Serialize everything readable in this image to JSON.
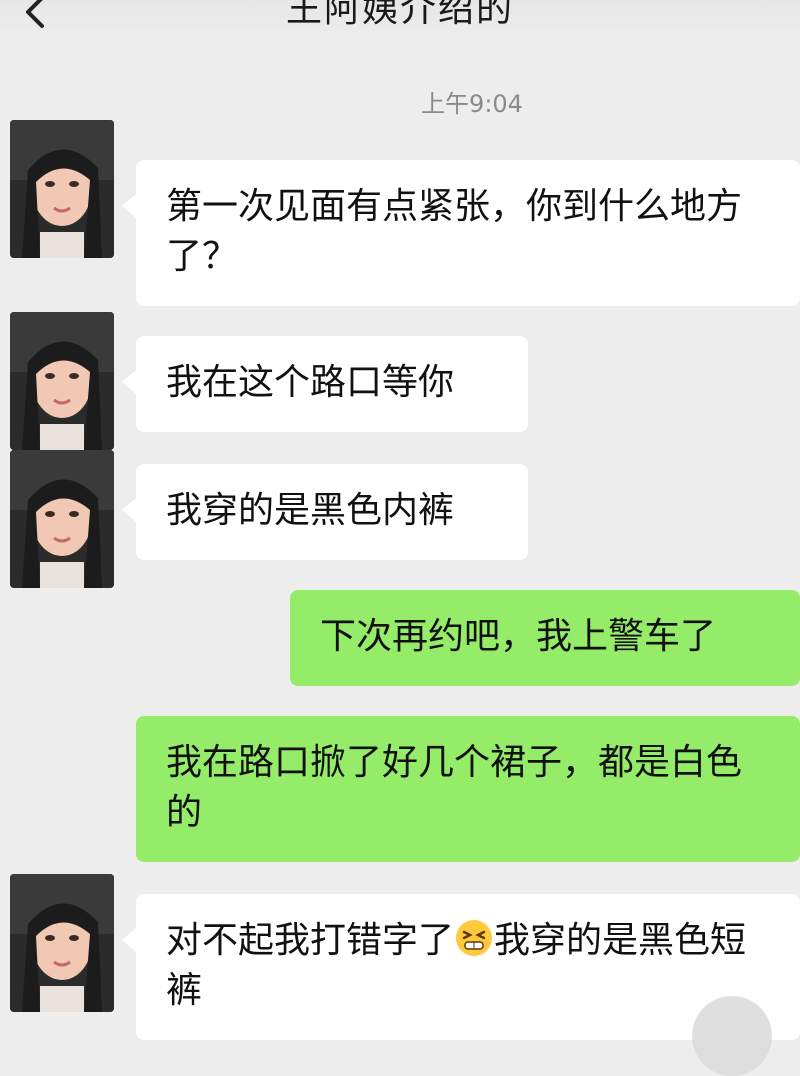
{
  "header": {
    "title": "王阿姨介绍的"
  },
  "time": "上午9:04",
  "messages": [
    {
      "text": "第一次见面有点紧张，你到什么地方了？"
    },
    {
      "text": "我在这个路口等你"
    },
    {
      "text": "我穿的是黑色内裤"
    },
    {
      "text": "下次再约吧，我上警车了"
    },
    {
      "text": "我在路口掀了好几个裙子，都是白色的"
    },
    {
      "text_before": "对不起我打错字了",
      "emoji": "grimace-emoji",
      "text_after": "我穿的是黑色短裤"
    }
  ],
  "colors": {
    "background": "#ededed",
    "incoming": "#ffffff",
    "outgoing": "#95ec69"
  }
}
